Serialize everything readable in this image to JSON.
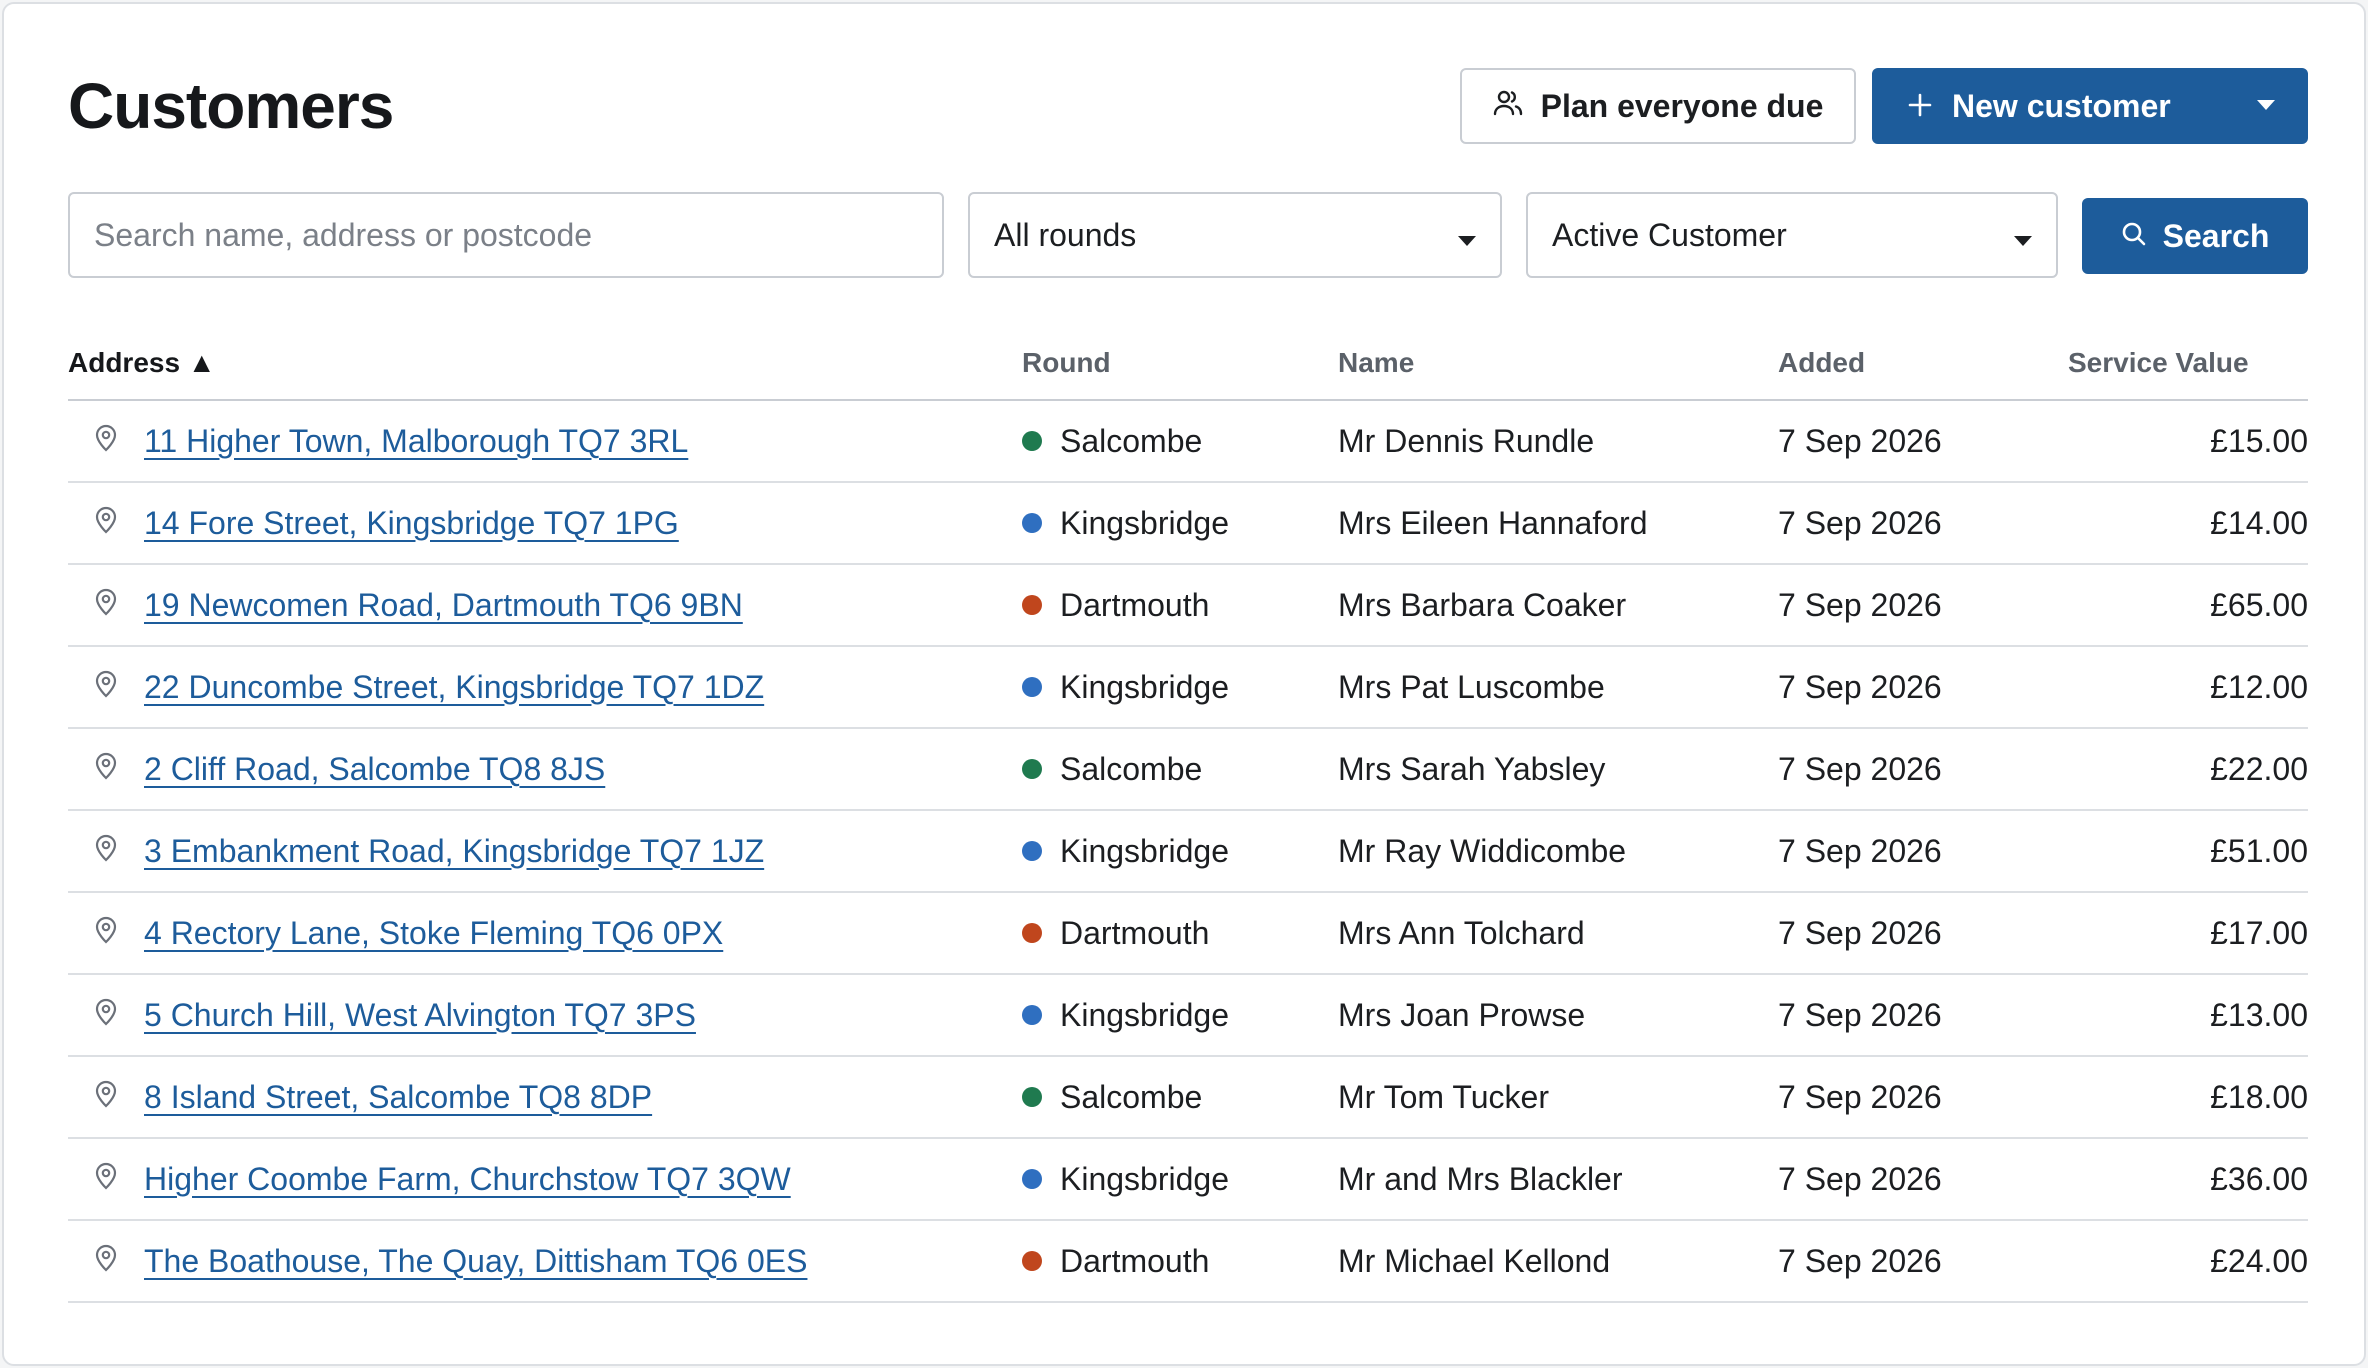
{
  "header": {
    "title": "Customers",
    "plan_label": "Plan everyone due",
    "new_customer_label": "New customer"
  },
  "filters": {
    "search_placeholder": "Search name, address or postcode",
    "search_value": "",
    "round_selected": "All rounds",
    "status_selected": "Active Customer",
    "search_button_label": "Search"
  },
  "colors": {
    "primary": "#1d5c9b",
    "round_salcombe": "#1f7a4f",
    "round_kingsbridge": "#2f6fc0",
    "round_dartmouth": "#c0461d"
  },
  "table": {
    "columns": [
      "Address ▲",
      "Round",
      "Name",
      "Added",
      "Service Value"
    ],
    "rows": [
      {
        "address": "11 Higher Town, Malborough TQ7 3RL",
        "round": "Salcombe",
        "round_color": "#1f7a4f",
        "name": "Mr Dennis Rundle",
        "added": "7 Sep 2026",
        "value": "£15.00"
      },
      {
        "address": "14 Fore Street, Kingsbridge TQ7 1PG",
        "round": "Kingsbridge",
        "round_color": "#2f6fc0",
        "name": "Mrs Eileen Hannaford",
        "added": "7 Sep 2026",
        "value": "£14.00"
      },
      {
        "address": "19 Newcomen Road, Dartmouth TQ6 9BN",
        "round": "Dartmouth",
        "round_color": "#c0461d",
        "name": "Mrs Barbara Coaker",
        "added": "7 Sep 2026",
        "value": "£65.00"
      },
      {
        "address": "22 Duncombe Street, Kingsbridge TQ7 1DZ",
        "round": "Kingsbridge",
        "round_color": "#2f6fc0",
        "name": "Mrs Pat Luscombe",
        "added": "7 Sep 2026",
        "value": "£12.00"
      },
      {
        "address": "2 Cliff Road, Salcombe TQ8 8JS",
        "round": "Salcombe",
        "round_color": "#1f7a4f",
        "name": "Mrs Sarah Yabsley",
        "added": "7 Sep 2026",
        "value": "£22.00"
      },
      {
        "address": "3 Embankment Road, Kingsbridge TQ7 1JZ",
        "round": "Kingsbridge",
        "round_color": "#2f6fc0",
        "name": "Mr Ray Widdicombe",
        "added": "7 Sep 2026",
        "value": "£51.00"
      },
      {
        "address": "4 Rectory Lane, Stoke Fleming TQ6 0PX",
        "round": "Dartmouth",
        "round_color": "#c0461d",
        "name": "Mrs Ann Tolchard",
        "added": "7 Sep 2026",
        "value": "£17.00"
      },
      {
        "address": "5 Church Hill, West Alvington TQ7 3PS",
        "round": "Kingsbridge",
        "round_color": "#2f6fc0",
        "name": "Mrs Joan Prowse",
        "added": "7 Sep 2026",
        "value": "£13.00"
      },
      {
        "address": "8 Island Street, Salcombe TQ8 8DP",
        "round": "Salcombe",
        "round_color": "#1f7a4f",
        "name": "Mr Tom Tucker",
        "added": "7 Sep 2026",
        "value": "£18.00"
      },
      {
        "address": "Higher Coombe Farm, Churchstow TQ7 3QW",
        "round": "Kingsbridge",
        "round_color": "#2f6fc0",
        "name": "Mr and Mrs Blackler",
        "added": "7 Sep 2026",
        "value": "£36.00"
      },
      {
        "address": "The Boathouse, The Quay, Dittisham TQ6 0ES",
        "round": "Dartmouth",
        "round_color": "#c0461d",
        "name": "Mr Michael Kellond",
        "added": "7 Sep 2026",
        "value": "£24.00"
      }
    ]
  },
  "icons": {
    "plan": "people-icon",
    "new": "plus-icon",
    "split_caret": "chevron-down-icon",
    "search": "search-icon",
    "address": "map-pin-icon"
  }
}
